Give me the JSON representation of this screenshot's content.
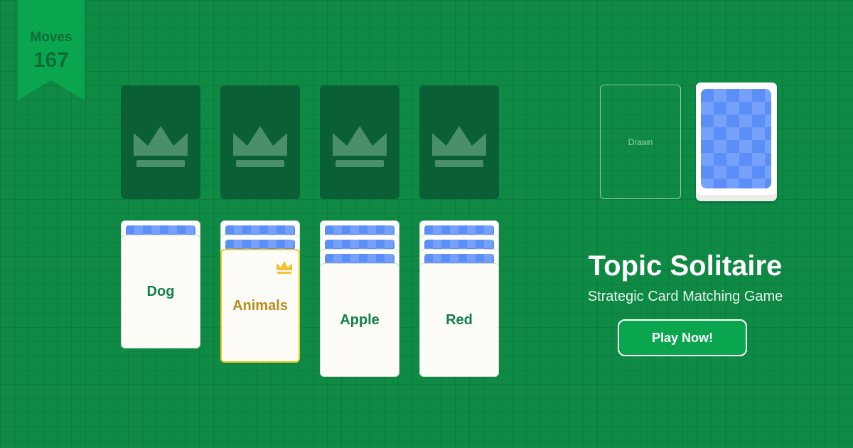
{
  "moves": {
    "label": "Moves",
    "value": "167"
  },
  "foundations": [
    {
      "icon": "crown-icon"
    },
    {
      "icon": "crown-icon"
    },
    {
      "icon": "crown-icon"
    },
    {
      "icon": "crown-icon"
    }
  ],
  "tableau": [
    {
      "face_down": 1,
      "card": "Dog",
      "topic": false
    },
    {
      "face_down": 2,
      "card": "Animals",
      "topic": true
    },
    {
      "face_down": 3,
      "card": "Apple",
      "topic": false
    },
    {
      "face_down": 3,
      "card": "Red",
      "topic": false
    }
  ],
  "drawn_label": "Drawn",
  "title": "Topic Solitaire",
  "subtitle": "Strategic Card Matching Game",
  "play_label": "Play Now!",
  "colors": {
    "felt": "#0e8a45",
    "accent": "#0aa54f",
    "topic": "#b98b1b",
    "card_back": "#5b8ef7"
  }
}
